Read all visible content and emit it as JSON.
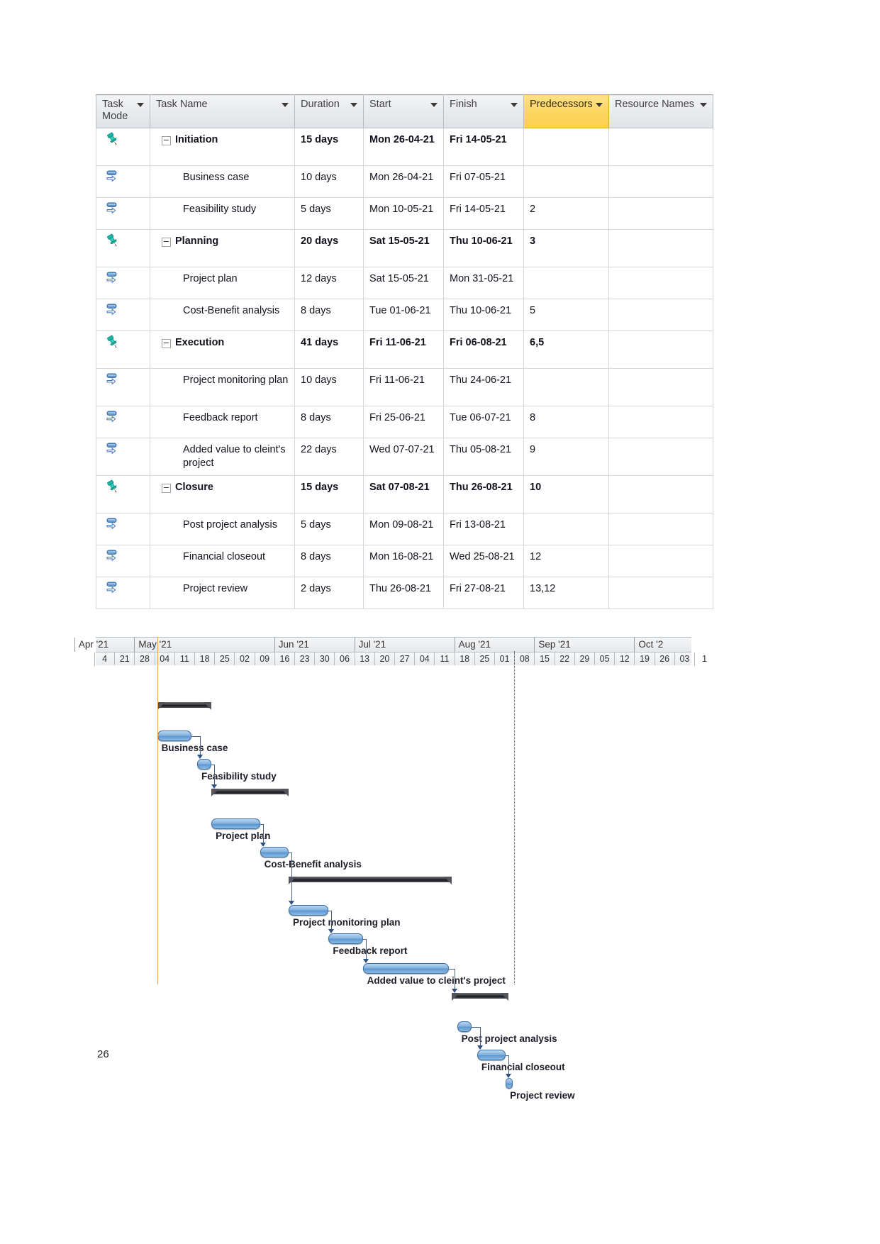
{
  "table": {
    "columns": [
      {
        "id": "task_mode",
        "label": "Task Mode",
        "highlight": false
      },
      {
        "id": "task_name",
        "label": "Task Name",
        "highlight": false
      },
      {
        "id": "duration",
        "label": "Duration",
        "highlight": false
      },
      {
        "id": "start",
        "label": "Start",
        "highlight": false
      },
      {
        "id": "finish",
        "label": "Finish",
        "highlight": false
      },
      {
        "id": "predecessors",
        "label": "Predecessors",
        "highlight": true,
        "highlight_color": "#fcd04f"
      },
      {
        "id": "resource_names",
        "label": "Resource Names",
        "highlight": false
      }
    ],
    "rows": [
      {
        "id": 1,
        "mode_icon": "pushpin-icon",
        "name": "Initiation",
        "summary": true,
        "duration": "15 days",
        "start": "Mon 26-04-21",
        "finish": "Fri 14-05-21",
        "predecessors": "",
        "resources": ""
      },
      {
        "id": 2,
        "mode_icon": "manual-task-icon",
        "name": "Business case",
        "summary": false,
        "duration": "10 days",
        "start": "Mon 26-04-21",
        "finish": "Fri 07-05-21",
        "predecessors": "",
        "resources": ""
      },
      {
        "id": 3,
        "mode_icon": "manual-task-icon",
        "name": "Feasibility study",
        "summary": false,
        "duration": "5 days",
        "start": "Mon 10-05-21",
        "finish": "Fri 14-05-21",
        "predecessors": "2",
        "resources": ""
      },
      {
        "id": 4,
        "mode_icon": "pushpin-icon",
        "name": "Planning",
        "summary": true,
        "duration": "20 days",
        "start": "Sat 15-05-21",
        "finish": "Thu 10-06-21",
        "predecessors": "3",
        "resources": ""
      },
      {
        "id": 5,
        "mode_icon": "manual-task-icon",
        "name": "Project plan",
        "summary": false,
        "duration": "12 days",
        "start": "Sat 15-05-21",
        "finish": "Mon 31-05-21",
        "predecessors": "",
        "resources": ""
      },
      {
        "id": 6,
        "mode_icon": "manual-task-icon",
        "name": "Cost-Benefit analysis",
        "summary": false,
        "duration": "8 days",
        "start": "Tue 01-06-21",
        "finish": "Thu 10-06-21",
        "predecessors": "5",
        "resources": ""
      },
      {
        "id": 7,
        "mode_icon": "pushpin-icon",
        "name": "Execution",
        "summary": true,
        "duration": "41 days",
        "start": "Fri 11-06-21",
        "finish": "Fri 06-08-21",
        "predecessors": "6,5",
        "resources": ""
      },
      {
        "id": 8,
        "mode_icon": "manual-task-icon",
        "name": "Project monitoring plan",
        "summary": false,
        "duration": "10 days",
        "start": "Fri 11-06-21",
        "finish": "Thu 24-06-21",
        "predecessors": "",
        "resources": ""
      },
      {
        "id": 9,
        "mode_icon": "manual-task-icon",
        "name": "Feedback report",
        "summary": false,
        "duration": "8 days",
        "start": "Fri 25-06-21",
        "finish": "Tue 06-07-21",
        "predecessors": "8",
        "resources": ""
      },
      {
        "id": 10,
        "mode_icon": "manual-task-icon",
        "name": "Added value to cleint's project",
        "summary": false,
        "duration": "22 days",
        "start": "Wed 07-07-21",
        "finish": "Thu 05-08-21",
        "predecessors": "9",
        "resources": ""
      },
      {
        "id": 11,
        "mode_icon": "pushpin-icon",
        "name": "Closure",
        "summary": true,
        "duration": "15 days",
        "start": "Sat 07-08-21",
        "finish": "Thu 26-08-21",
        "predecessors": "10",
        "resources": ""
      },
      {
        "id": 12,
        "mode_icon": "manual-task-icon",
        "name": "Post project analysis",
        "summary": false,
        "duration": "5 days",
        "start": "Mon 09-08-21",
        "finish": "Fri 13-08-21",
        "predecessors": "",
        "resources": ""
      },
      {
        "id": 13,
        "mode_icon": "manual-task-icon",
        "name": "Financial closeout",
        "summary": false,
        "duration": "8 days",
        "start": "Mon 16-08-21",
        "finish": "Wed 25-08-21",
        "predecessors": "12",
        "resources": ""
      },
      {
        "id": 14,
        "mode_icon": "manual-task-icon",
        "name": "Project review",
        "summary": false,
        "duration": "2 days",
        "start": "Thu 26-08-21",
        "finish": "Fri 27-08-21",
        "predecessors": "13,12",
        "resources": ""
      }
    ]
  },
  "chart_data": {
    "type": "bar",
    "chart_kind": "gantt",
    "title": "",
    "xlabel": "",
    "ylabel": "",
    "timescale": {
      "top_tier": "months",
      "bottom_tier": "week-start-day",
      "months": [
        "Apr '21",
        "May '21",
        "Jun '21",
        "Jul '21",
        "Aug '21",
        "Sep '21",
        "Oct '2"
      ],
      "week_ticks": [
        "4",
        "21",
        "28",
        "04",
        "11",
        "18",
        "25",
        "02",
        "09",
        "16",
        "23",
        "30",
        "06",
        "13",
        "20",
        "27",
        "04",
        "11",
        "18",
        "25",
        "01",
        "08",
        "15",
        "22",
        "29",
        "05",
        "12",
        "19",
        "26",
        "03",
        "1"
      ]
    },
    "bars": [
      {
        "name": "Initiation",
        "kind": "summary",
        "start": "2021-04-26",
        "finish": "2021-05-14",
        "duration_days": 15,
        "label": ""
      },
      {
        "name": "Business case",
        "kind": "task",
        "start": "2021-04-26",
        "finish": "2021-05-07",
        "duration_days": 10,
        "label": "Business case"
      },
      {
        "name": "Feasibility study",
        "kind": "task",
        "start": "2021-05-10",
        "finish": "2021-05-14",
        "duration_days": 5,
        "label": "Feasibility study"
      },
      {
        "name": "Planning",
        "kind": "summary",
        "start": "2021-05-15",
        "finish": "2021-06-10",
        "duration_days": 20,
        "label": ""
      },
      {
        "name": "Project plan",
        "kind": "task",
        "start": "2021-05-15",
        "finish": "2021-05-31",
        "duration_days": 12,
        "label": "Project plan"
      },
      {
        "name": "Cost-Benefit analysis",
        "kind": "task",
        "start": "2021-06-01",
        "finish": "2021-06-10",
        "duration_days": 8,
        "label": "Cost-Benefit analysis"
      },
      {
        "name": "Execution",
        "kind": "summary",
        "start": "2021-06-11",
        "finish": "2021-08-06",
        "duration_days": 41,
        "label": ""
      },
      {
        "name": "Project monitoring plan",
        "kind": "task",
        "start": "2021-06-11",
        "finish": "2021-06-24",
        "duration_days": 10,
        "label": "Project monitoring plan"
      },
      {
        "name": "Feedback report",
        "kind": "task",
        "start": "2021-06-25",
        "finish": "2021-07-06",
        "duration_days": 8,
        "label": "Feedback report"
      },
      {
        "name": "Added value to cleint's project",
        "kind": "task",
        "start": "2021-07-07",
        "finish": "2021-08-05",
        "duration_days": 22,
        "label": "Added value to cleint's project"
      },
      {
        "name": "Closure",
        "kind": "summary",
        "start": "2021-08-07",
        "finish": "2021-08-26",
        "duration_days": 15,
        "label": ""
      },
      {
        "name": "Post project analysis",
        "kind": "task",
        "start": "2021-08-09",
        "finish": "2021-08-13",
        "duration_days": 5,
        "label": "Post project analysis"
      },
      {
        "name": "Financial closeout",
        "kind": "task",
        "start": "2021-08-16",
        "finish": "2021-08-25",
        "duration_days": 8,
        "label": "Financial closeout"
      },
      {
        "name": "Project review",
        "kind": "task",
        "start": "2021-08-26",
        "finish": "2021-08-27",
        "duration_days": 2,
        "label": "Project review"
      }
    ],
    "bar_labels": [
      "Business case",
      "Feasibility study",
      "Project plan",
      "Cost-Benefit analysis",
      "Project monitoring plan",
      "Feedback report",
      "Added value to cleint's project",
      "Post project analysis",
      "Financial closeout",
      "Project review"
    ],
    "markers": [
      {
        "name": "project-start-line",
        "color": "#e8a15a",
        "style": "solid"
      },
      {
        "name": "today-line",
        "color": "#55555f",
        "style": "dotted"
      }
    ],
    "colors": {
      "task_bar": "#5e97cf",
      "task_bar_border": "#3d6fa5",
      "summary_bar": "#17181c",
      "link_line": "#4a5f84",
      "predecessor_header": "#fcd04f"
    },
    "legend": []
  },
  "footer": {
    "page_number": "26"
  }
}
